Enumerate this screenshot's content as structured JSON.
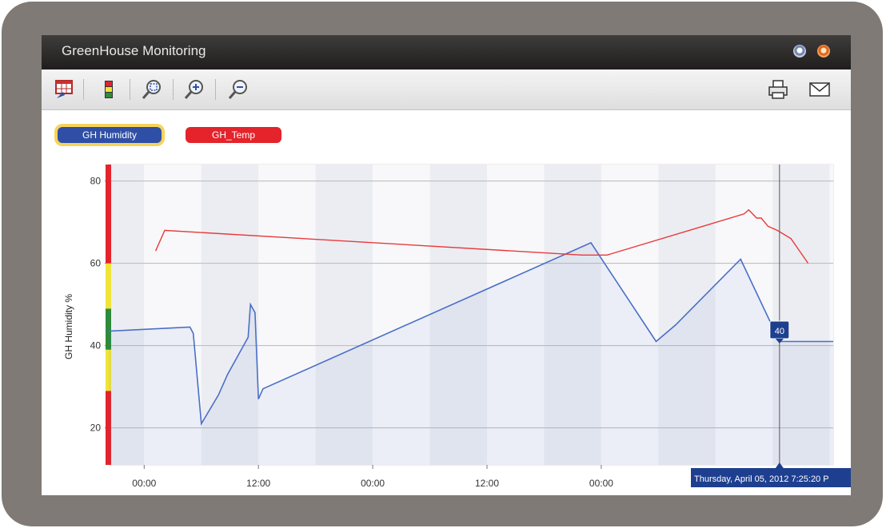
{
  "window": {
    "title": "GreenHouse Monitoring"
  },
  "toolbar": {
    "icons": [
      "table-icon",
      "alarm-levels-icon",
      "zoom-fit-icon",
      "zoom-in-icon",
      "zoom-out-icon",
      "print-icon",
      "email-icon"
    ]
  },
  "legend": {
    "humidity_label": "GH Humidity",
    "temp_label": "GH_Temp"
  },
  "colors": {
    "humidity": "#4a6fc8",
    "temp": "#e83a3a",
    "alarm_red": "#e4232b",
    "alarm_yellow": "#f0e43a",
    "alarm_green": "#2e8b3a",
    "tooltip": "#1e3f8f"
  },
  "chart_data": {
    "type": "line",
    "ylabel": "GH Humidity %",
    "ylim": [
      11,
      84
    ],
    "yticks": [
      20,
      40,
      60,
      80
    ],
    "xlim": [
      -3.1,
      60.3
    ],
    "xticks": [
      {
        "x": 0,
        "label": "00:00"
      },
      {
        "x": 10,
        "label": "12:00"
      },
      {
        "x": 20,
        "label": "00:00"
      },
      {
        "x": 30,
        "label": "12:00"
      },
      {
        "x": 40,
        "label": "00:00"
      }
    ],
    "alarm_bands": [
      {
        "from": 11,
        "to": 29,
        "color": "red"
      },
      {
        "from": 29,
        "to": 39,
        "color": "yellow"
      },
      {
        "from": 39,
        "to": 49,
        "color": "green"
      },
      {
        "from": 49,
        "to": 60,
        "color": "yellow"
      },
      {
        "from": 60,
        "to": 84,
        "color": "red"
      }
    ],
    "series": [
      {
        "name": "GH Humidity",
        "points": [
          [
            -3.1,
            43.5
          ],
          [
            4,
            44.5
          ],
          [
            4.3,
            43
          ],
          [
            5,
            21
          ],
          [
            6.5,
            28
          ],
          [
            7.3,
            33
          ],
          [
            9.1,
            42
          ],
          [
            9.3,
            50
          ],
          [
            9.7,
            48
          ],
          [
            10.0,
            27
          ],
          [
            10.4,
            29.5
          ],
          [
            39.1,
            65
          ],
          [
            44.8,
            41
          ],
          [
            46.5,
            45
          ],
          [
            52.2,
            61
          ],
          [
            55.6,
            41
          ],
          [
            60.3,
            41
          ]
        ]
      },
      {
        "name": "GH_Temp",
        "points": [
          [
            1,
            63
          ],
          [
            1.8,
            68
          ],
          [
            38.3,
            62
          ],
          [
            40.5,
            62
          ],
          [
            52.5,
            72
          ],
          [
            52.9,
            73
          ],
          [
            53.6,
            71
          ],
          [
            54,
            71
          ],
          [
            54.6,
            69
          ],
          [
            55.4,
            68
          ],
          [
            56.6,
            66
          ],
          [
            57.1,
            64
          ],
          [
            58.1,
            60
          ]
        ]
      }
    ],
    "cursor": {
      "x": 55.6,
      "value_label": "40",
      "datetime_label": "Thursday, April 05, 2012 7:25:20 P"
    }
  }
}
